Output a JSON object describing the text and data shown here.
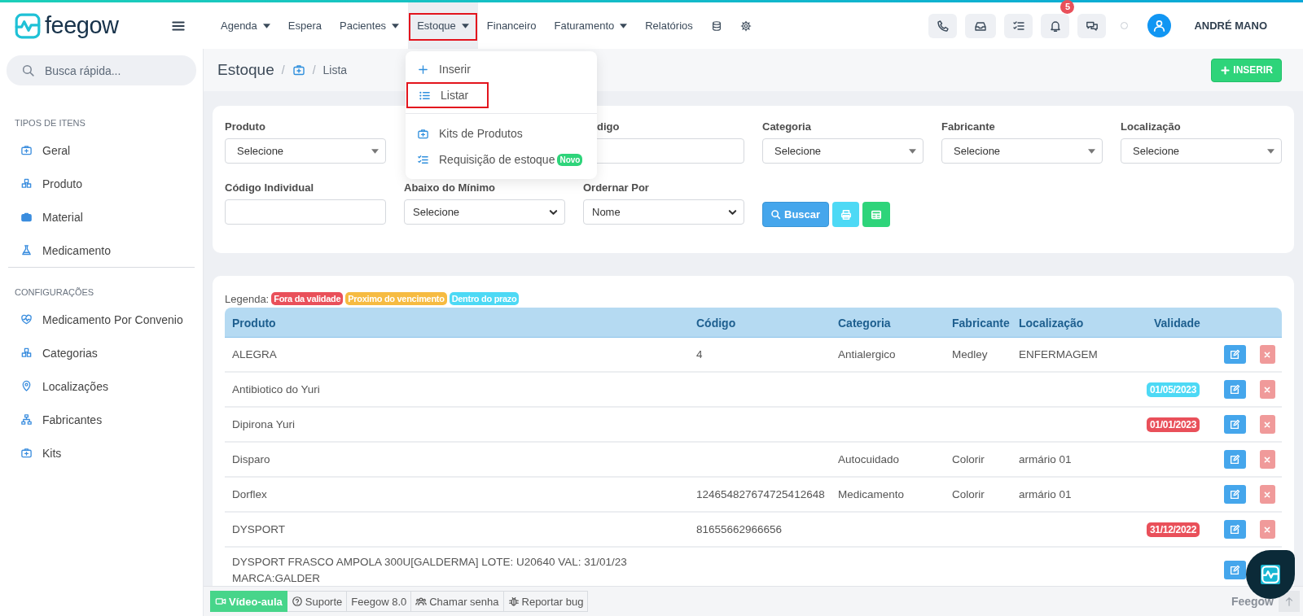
{
  "topbar": {
    "brand": "feegow",
    "nav": [
      {
        "label": "Agenda",
        "caret": true,
        "selected": false
      },
      {
        "label": "Espera",
        "caret": false,
        "selected": false
      },
      {
        "label": "Pacientes",
        "caret": true,
        "selected": false
      },
      {
        "label": "Estoque",
        "caret": true,
        "selected": true
      },
      {
        "label": "Financeiro",
        "caret": false,
        "selected": false
      },
      {
        "label": "Faturamento",
        "caret": true,
        "selected": false
      },
      {
        "label": "Relatórios",
        "caret": false,
        "selected": false
      }
    ],
    "actions": [
      {
        "kind": "phone"
      },
      {
        "kind": "inbox"
      },
      {
        "kind": "checklist"
      },
      {
        "kind": "bell",
        "badge": "5"
      },
      {
        "kind": "chat"
      }
    ],
    "user": "ANDRÉ MANO"
  },
  "nav_menu": {
    "sections": [
      [
        {
          "label": "Inserir",
          "selected": false
        },
        {
          "label": "Listar",
          "selected": true
        }
      ],
      [
        {
          "label": "Kits de Produtos",
          "selected": false
        },
        {
          "label": "Requisição de estoque",
          "selected": false,
          "badge": "Novo"
        }
      ]
    ]
  },
  "sidebar": {
    "search": {
      "placeholder": "Busca rápida..."
    },
    "sections": [
      {
        "title": "TIPOS DE ITENS",
        "items": [
          {
            "label": "Geral"
          },
          {
            "label": "Produto"
          },
          {
            "label": "Material"
          },
          {
            "label": "Medicamento"
          }
        ]
      },
      {
        "title": "CONFIGURAÇÕES",
        "items": [
          {
            "label": "Medicamento Por Convenio"
          },
          {
            "label": "Categorias"
          },
          {
            "label": "Localizações"
          },
          {
            "label": "Fabricantes"
          },
          {
            "label": "Kits"
          }
        ]
      }
    ]
  },
  "breadcrumb": {
    "title": "Estoque",
    "separator_1": "/",
    "separator_2": "/",
    "current": "Lista",
    "action": "INSERIR"
  },
  "filters": {
    "row_1": [
      {
        "label": "Produto",
        "kind": "combo",
        "value": "Selecione"
      },
      {
        "label": "digo",
        "kind": "text"
      },
      {
        "label": "Categoria",
        "kind": "combo",
        "value": "Selecione"
      },
      {
        "label": "Fabricante",
        "kind": "combo",
        "value": "Selecione"
      },
      {
        "label": "Localização",
        "kind": "combo",
        "value": "Selecione"
      }
    ],
    "row_2": [
      {
        "label": "Código Individual",
        "kind": "text"
      },
      {
        "label": "Abaixo do Mínimo",
        "kind": "select",
        "value": "Selecione"
      },
      {
        "label": "Ordernar Por",
        "kind": "select",
        "value": "Nome"
      }
    ],
    "search_button": "Buscar"
  },
  "legend": {
    "label": "Legenda:",
    "items": [
      {
        "label": "Fora da validade",
        "color": "#e9505a"
      },
      {
        "label": "Proximo do vencimento",
        "color": "#f6bb42"
      },
      {
        "label": "Dentro do prazo",
        "color": "#4dd9f5"
      }
    ]
  },
  "table": {
    "columns": [
      "Produto",
      "Código",
      "Categoria",
      "Fabricante",
      "Localização",
      "Validade"
    ],
    "rows": [
      {
        "product": "ALEGRA",
        "code": "4",
        "category": "Antialergico",
        "manufacturer": "Medley",
        "location": "ENFERMAGEM"
      },
      {
        "product": "Antibiotico do Yuri",
        "validity": {
          "text": "01/05/2023",
          "color": "#4dd9f5"
        }
      },
      {
        "product": "Dipirona Yuri",
        "validity": {
          "text": "01/01/2023",
          "color": "#e9505a"
        }
      },
      {
        "product": "Disparo",
        "category": "Autocuidado",
        "manufacturer": "Colorir",
        "location": "armário 01"
      },
      {
        "product": "Dorflex",
        "code": "124654827674725412648",
        "category": "Medicamento",
        "manufacturer": "Colorir",
        "location": "armário 01"
      },
      {
        "product": "DYSPORT",
        "code": "81655662966656",
        "validity": {
          "text": "31/12/2022",
          "color": "#e9505a"
        }
      },
      {
        "product": "DYSPORT FRASCO AMPOLA 300U[GALDERMA] LOTE: U20640 VAL: 31/01/23 MARCA:GALDER"
      }
    ]
  },
  "footer": {
    "items": [
      {
        "label": "Vídeo-aula",
        "kind": "primary"
      },
      {
        "label": "Suporte",
        "kind": "plain"
      },
      {
        "label": "Feegow 8.0",
        "kind": "plain"
      },
      {
        "label": "Chamar senha",
        "kind": "plain"
      },
      {
        "label": "Reportar bug",
        "kind": "plain"
      }
    ],
    "brand": "Feegow"
  }
}
